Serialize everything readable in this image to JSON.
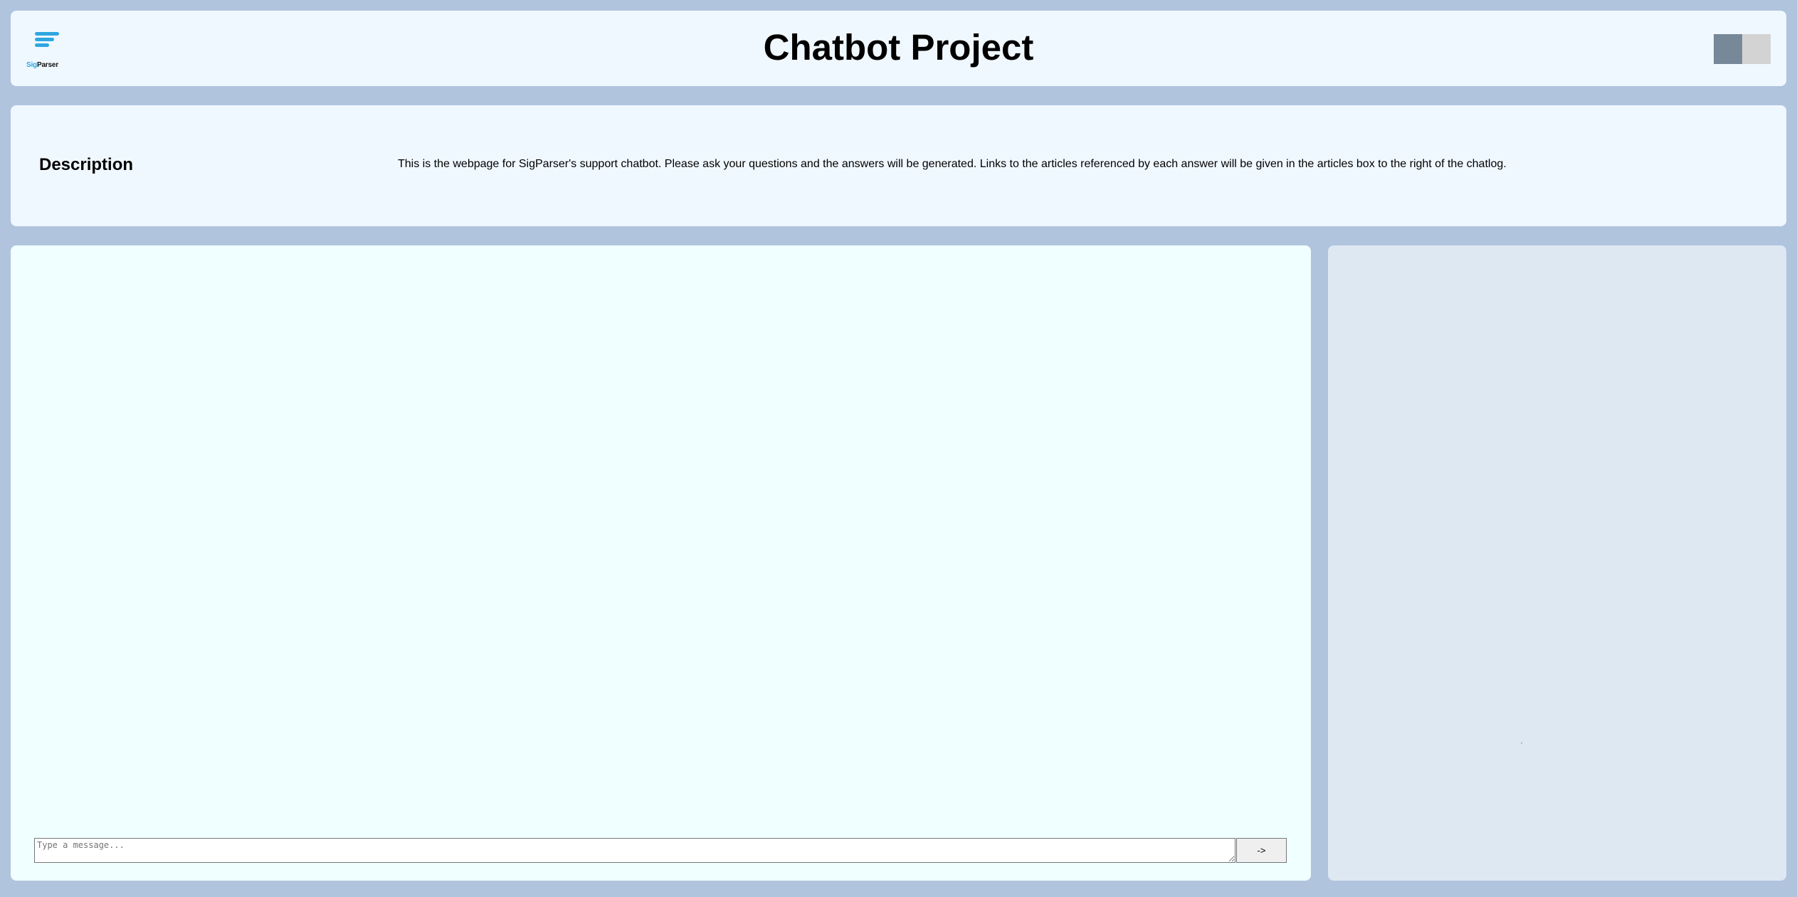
{
  "header": {
    "logo": {
      "text_part1": "Sig",
      "text_part2": "Parser",
      "accent_color": "#2ea7e0"
    },
    "title": "Chatbot Project",
    "theme_toggle": {
      "dark_color": "#778899",
      "light_color": "#d3d3d3"
    }
  },
  "description": {
    "heading": "Description",
    "text": "This is the webpage for SigParser's support chatbot. Please ask your questions and the answers will be generated. Links to the articles referenced by each answer will be given in the articles box to the right of the chatlog."
  },
  "chat": {
    "messages": [],
    "input_value": "",
    "input_placeholder": "Type a message...",
    "send_label": "->"
  },
  "articles": {
    "items": []
  },
  "colors": {
    "page_background": "#b0c4de",
    "panel_background": "#f0f8ff",
    "chat_background": "#f0ffff",
    "articles_background": "#dde8f2"
  }
}
